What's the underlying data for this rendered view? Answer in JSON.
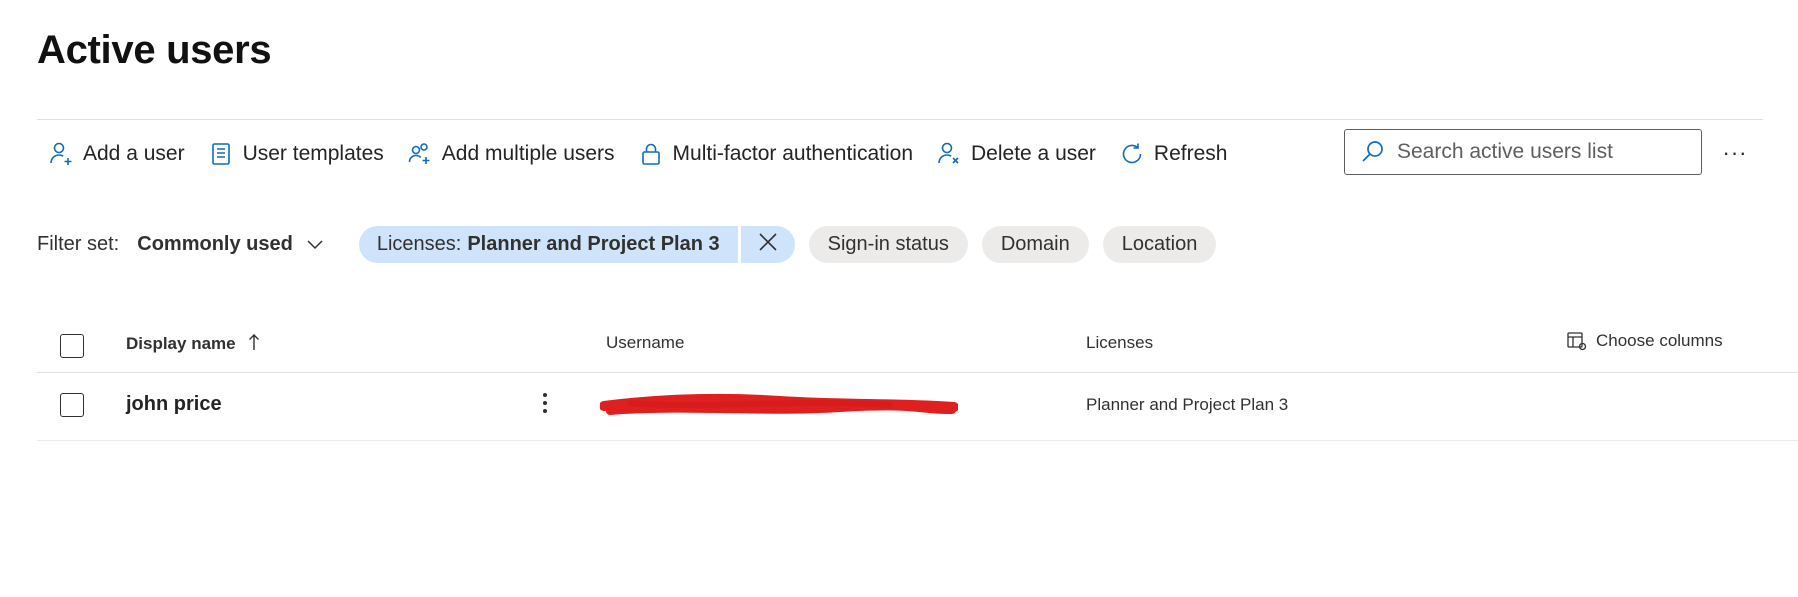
{
  "page": {
    "title": "Active users"
  },
  "toolbar": {
    "add_user": "Add a user",
    "user_templates": "User templates",
    "add_multiple_users": "Add multiple users",
    "mfa": "Multi-factor authentication",
    "delete_user": "Delete a user",
    "refresh": "Refresh",
    "more": "···",
    "accent_color": "#0f6cbd"
  },
  "search": {
    "placeholder": "Search active users list",
    "value": ""
  },
  "filters": {
    "set_label": "Filter set:",
    "set_value": "Commonly used",
    "active_filter": {
      "prefix": "Licenses:",
      "value": "Planner and Project Plan 3",
      "background": "#cfe4fa"
    },
    "pills": [
      "Sign-in status",
      "Domain",
      "Location"
    ]
  },
  "table": {
    "columns": {
      "display_name": "Display name",
      "username": "Username",
      "licenses": "Licenses",
      "choose_columns": "Choose columns"
    },
    "rows": [
      {
        "display_name": "john price",
        "username": "[redacted]",
        "licenses": "Planner and Project Plan 3"
      }
    ]
  }
}
